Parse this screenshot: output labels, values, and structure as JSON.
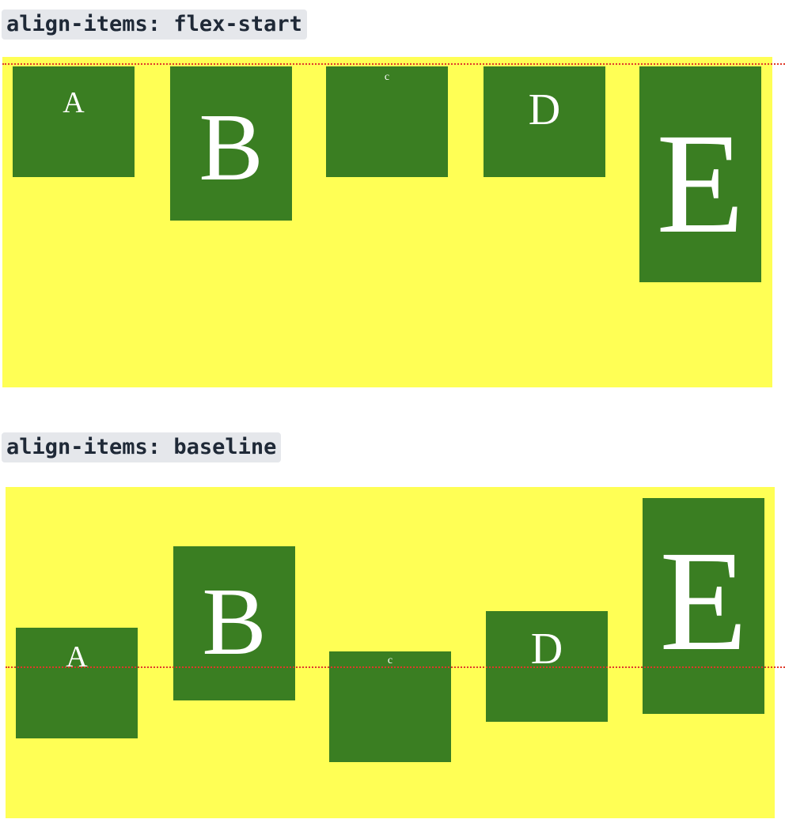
{
  "sections": [
    {
      "label": "align-items: flex-start",
      "items": [
        {
          "letter": "A"
        },
        {
          "letter": "B"
        },
        {
          "letter": "c"
        },
        {
          "letter": "D"
        },
        {
          "letter": "E"
        }
      ]
    },
    {
      "label": "align-items: baseline",
      "items": [
        {
          "letter": "A"
        },
        {
          "letter": "B"
        },
        {
          "letter": "c"
        },
        {
          "letter": "D"
        },
        {
          "letter": "E"
        }
      ]
    }
  ],
  "colors": {
    "container_bg": "#ffff55",
    "item_bg": "#3a7e22",
    "item_text": "#ffffff",
    "guide_line": "#e0392a",
    "label_bg": "#e5e7eb"
  }
}
